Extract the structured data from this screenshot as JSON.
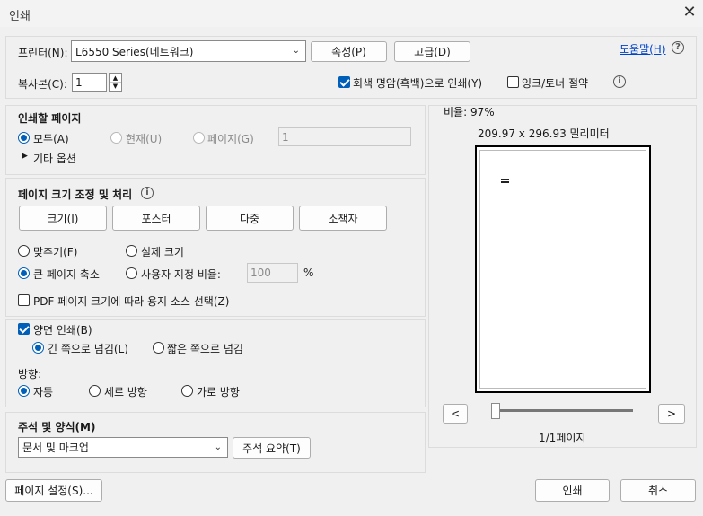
{
  "window": {
    "title": "인쇄",
    "close": "✕"
  },
  "printer": {
    "label": "프린터(N):",
    "selected": "L6550 Series(네트워크)",
    "properties_button": "속성(P)",
    "advanced_button": "고급(D)",
    "help_link": "도움말(H)",
    "help_icon": "?"
  },
  "copies": {
    "label": "복사본(C):",
    "value": "1"
  },
  "options": {
    "grayscale_label": "회색 명암(흑백)으로 인쇄(Y)",
    "grayscale_checked": true,
    "save_ink_label": "잉크/토너 절약",
    "save_ink_checked": false
  },
  "pages_to_print": {
    "heading": "인쇄할 페이지",
    "all": "모두(A)",
    "current": "현재(U)",
    "pages": "페이지(G)",
    "pages_value": "1",
    "more_options": "기타 옵션"
  },
  "sizing": {
    "heading": "페이지 크기 조정 및 처리",
    "buttons": [
      "크기(I)",
      "포스터",
      "다중",
      "소책자"
    ],
    "fit": "맞추기(F)",
    "actual_size": "실제 크기",
    "shrink": "큰 페이지 축소",
    "custom_scale": "사용자 지정 비율:",
    "scale_value": "100",
    "percent": "%",
    "pdf_source": "PDF 페이지 크기에 따라 용지 소스 선택(Z)"
  },
  "duplex": {
    "label": "양면 인쇄(B)",
    "checked": true,
    "long_edge": "긴 쪽으로 넘김(L)",
    "short_edge": "짧은 쪽으로 넘김"
  },
  "orientation": {
    "label": "방향:",
    "auto": "자동",
    "portrait": "세로 방향",
    "landscape": "가로 방향"
  },
  "comments": {
    "heading": "주석 및 양식(M)",
    "selected": "문서 및 마크업",
    "summarize_button": "주석 요약(T)"
  },
  "preview": {
    "scale": "비율: 97%",
    "dimensions": "209.97 x 296.93 밀리미터",
    "prev": "<",
    "next": ">",
    "page_indicator": "1/1페이지"
  },
  "footer": {
    "page_setup": "페이지 설정(S)...",
    "print": "인쇄",
    "cancel": "취소"
  }
}
